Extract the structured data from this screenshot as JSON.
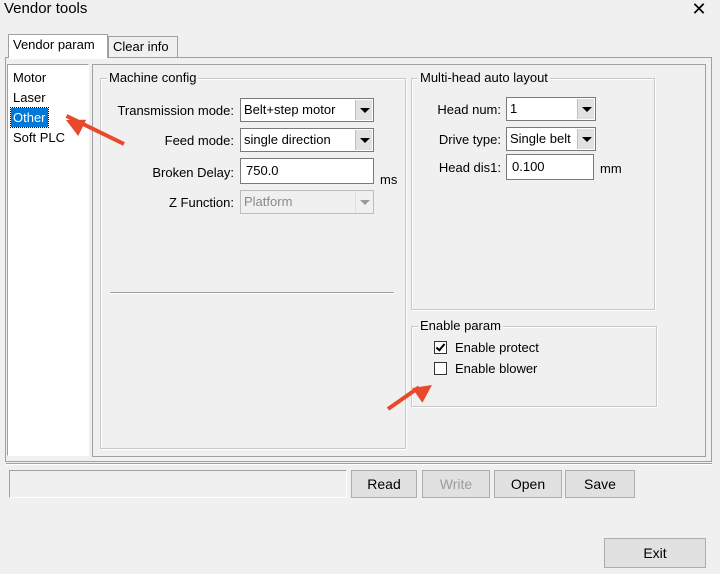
{
  "window": {
    "title": "Vendor tools",
    "close_glyph": "✕"
  },
  "tabs": [
    {
      "label": "Vendor param",
      "active": true
    },
    {
      "label": "Clear info",
      "active": false
    }
  ],
  "sidebar": {
    "items": [
      {
        "label": "Motor",
        "selected": false
      },
      {
        "label": "Laser",
        "selected": false
      },
      {
        "label": "Other",
        "selected": true
      },
      {
        "label": "Soft PLC",
        "selected": false
      }
    ]
  },
  "machine_config": {
    "title": "Machine config",
    "transmission_mode": {
      "label": "Transmission mode:",
      "value": "Belt+step motor"
    },
    "feed_mode": {
      "label": "Feed mode:",
      "value": "single direction"
    },
    "broken_delay": {
      "label": "Broken Delay:",
      "value": "750.0",
      "unit": "ms"
    },
    "z_function": {
      "label": "Z Function:",
      "value": "Platform",
      "disabled": true
    }
  },
  "multi_head": {
    "title": "Multi-head auto layout",
    "head_num": {
      "label": "Head num:",
      "value": "1"
    },
    "drive_type": {
      "label": "Drive type:",
      "value": "Single belt"
    },
    "head_dis1": {
      "label": "Head dis1:",
      "value": "0.100",
      "unit": "mm"
    }
  },
  "enable_param": {
    "title": "Enable param",
    "enable_protect": {
      "label": "Enable protect",
      "checked": true
    },
    "enable_blower": {
      "label": "Enable blower",
      "checked": false
    }
  },
  "buttons": {
    "read": "Read",
    "write": "Write",
    "open": "Open",
    "save": "Save",
    "exit": "Exit"
  },
  "annotation_color": "#e8492c"
}
